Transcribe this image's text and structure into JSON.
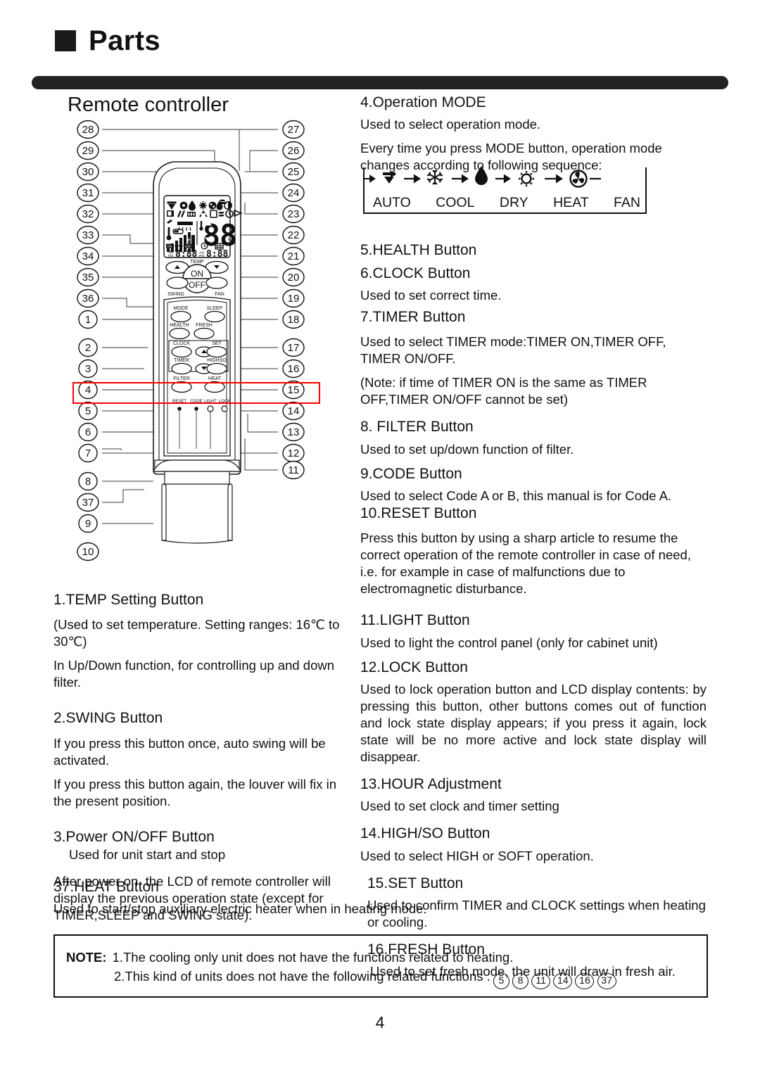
{
  "header": {
    "title": "Parts",
    "bullet": "square-bullet"
  },
  "section": {
    "title": "Remote controller"
  },
  "diagram": {
    "name": "remote-controller-diagram",
    "left_callouts": [
      28,
      29,
      30,
      31,
      32,
      33,
      34,
      35,
      36,
      1,
      2,
      3,
      4,
      5,
      6,
      7,
      8,
      37,
      9,
      10
    ],
    "right_callouts": [
      27,
      26,
      25,
      24,
      23,
      22,
      21,
      20,
      19,
      18,
      17,
      16,
      15,
      14,
      13,
      12,
      11
    ],
    "button_labels": [
      "TEMP",
      "ON",
      "OFF",
      "SWING",
      "FAN",
      "MODE",
      "SLEEP",
      "HEALTH",
      "FRESH",
      "CLOCK",
      "SET",
      "TIMER",
      "HIGH/SO",
      "FILTER",
      "HEAT",
      "RESET",
      "CODE",
      "LIGHT",
      "LOCK"
    ],
    "lcd": {
      "temp_digits": "88",
      "time_left": "8:88",
      "time_right": "8:88",
      "am": "AM",
      "pm": "PM",
      "on_tag": "ON",
      "off_tag": "OFF",
      "md": [
        "M",
        "D"
      ],
      "percent": "%",
      "celsius": "℃",
      "auto_bar": "AUTO"
    },
    "highlight_color": "#ff0000"
  },
  "mode_sequence": {
    "items": [
      {
        "icon": "auto-icon",
        "label": "AUTO"
      },
      {
        "icon": "snowflake-icon",
        "label": "COOL"
      },
      {
        "icon": "droplet-icon",
        "label": "DRY"
      },
      {
        "icon": "sun-icon",
        "label": "HEAT"
      },
      {
        "icon": "fan-icon",
        "label": "FAN"
      }
    ]
  },
  "left_column": [
    {
      "num": "1.",
      "heading": "1.TEMP Setting Button",
      "paras": [
        "(Used to set temperature. Setting ranges: 16℃ to 30℃)",
        "In Up/Down function, for controlling up and down filter."
      ]
    },
    {
      "num": "2.",
      "heading": "2.SWING Button",
      "paras": [
        "If you press this button once, auto swing will be activated.",
        "If you press this button again, the louver will fix in the present position."
      ]
    },
    {
      "num": "3.",
      "heading": "3.Power ON/OFF Button",
      "indented": "Used for unit start and stop",
      "paras": [
        "After power on, the LCD of remote controller will display the previous operation state (except for TIMER,SLEEP and SWING state)."
      ]
    }
  ],
  "heat37": {
    "heading": "37.HEAT Button",
    "para": "Used to start/stop auxiliary electric heater when in heating mode."
  },
  "right_column": {
    "op_mode": {
      "heading": "4.Operation MODE",
      "para1": "Used to select operation mode.",
      "para2": "Every time you press MODE button, operation mode changes according to following sequence:"
    },
    "items": [
      {
        "heading": "5.HEALTH Button",
        "paras": []
      },
      {
        "heading": "6.CLOCK Button",
        "paras": [
          "Used to set correct time."
        ]
      },
      {
        "heading": "7.TIMER Button",
        "paras": [
          "Used to select TIMER mode:TIMER ON,TIMER OFF, TIMER ON/OFF.",
          "(Note: if time of TIMER ON is the same as TIMER OFF,TIMER ON/OFF cannot be set)"
        ]
      },
      {
        "heading": "8. FILTER Button",
        "paras": [
          "Used to set up/down function of filter."
        ]
      },
      {
        "heading": "9.CODE Button",
        "paras": [
          "Used to select Code A or B, this manual is for Code A."
        ]
      },
      {
        "heading": "10.RESET Button",
        "paras": [
          "Press this button by using a sharp article to resume the correct operation of the remote controller in case of need, i.e. for example in case of malfunctions due to electromagnetic disturbance."
        ]
      },
      {
        "heading": "11.LIGHT Button",
        "paras": [
          "Used to light the control panel (only for cabinet unit)"
        ]
      },
      {
        "heading": "12.LOCK Button",
        "paras": [
          "Used to lock operation button and LCD display contents: by pressing this button, other buttons comes out of function and lock state display appears; if you press it again, lock state will be no more active and lock state display will disappear."
        ]
      },
      {
        "heading": "13.HOUR Adjustment",
        "paras": [
          "Used to set clock and timer setting"
        ]
      },
      {
        "heading": "14.HIGH/SO Button",
        "paras": [
          "Used to select HIGH or SOFT operation."
        ]
      },
      {
        "heading": "15.SET Button",
        "paras": [
          "Used to confirm TIMER and CLOCK settings when heating or cooling."
        ]
      },
      {
        "heading": "16.FRESH Button",
        "paras": [
          "Used to set fresh mode, the unit will draw in fresh air."
        ]
      }
    ]
  },
  "note": {
    "label": "NOTE:",
    "line1": "1.The cooling only  unit does not have the functions related to heating.",
    "line2": "2.This kind of units does not have the following related functions :",
    "functions": [
      5,
      8,
      11,
      14,
      16,
      37
    ]
  },
  "page_number": "4"
}
